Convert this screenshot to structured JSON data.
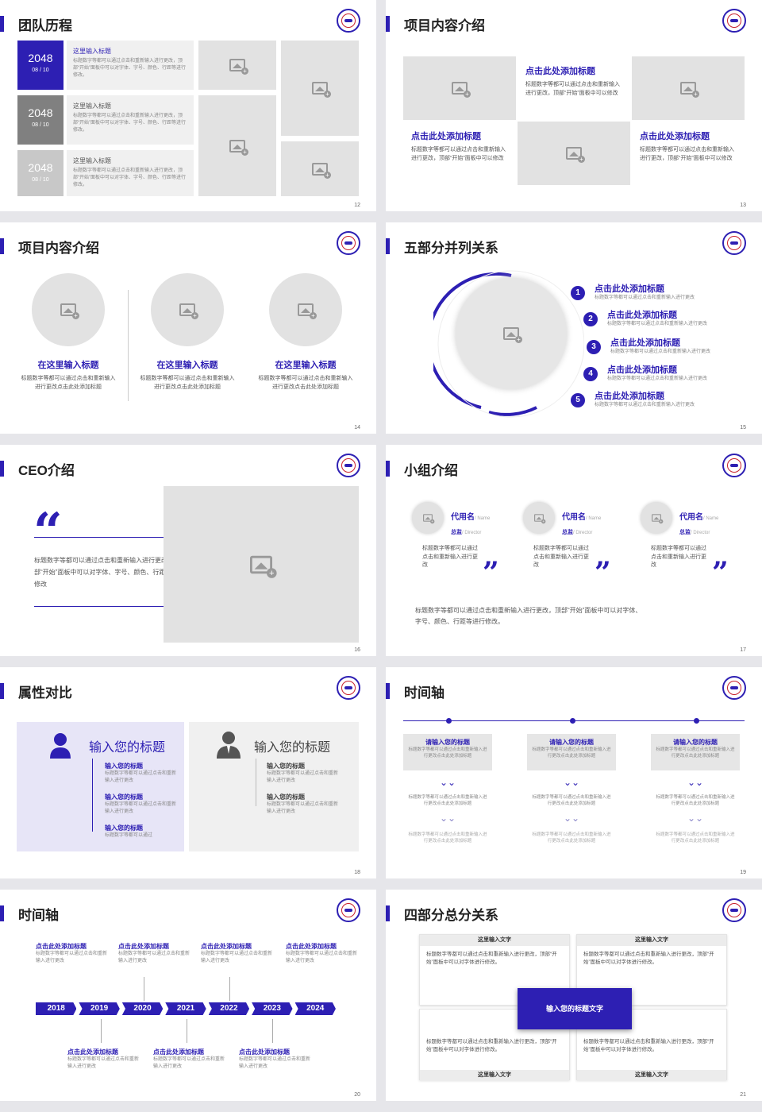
{
  "s12": {
    "title": "团队历程",
    "page": "12",
    "items": [
      {
        "year": "2048",
        "date": "08 / 10",
        "title": "这里输入标题",
        "text": "标题数字等都可以通过点击和重新输入进行更改，顶部“开始”面板中可以对字体、字号、颜色、行距等进行修改。"
      },
      {
        "year": "2048",
        "date": "08 / 10",
        "title": "这里输入标题",
        "text": "标题数字等都可以通过点击和重新输入进行更改，顶部“开始”面板中可以对字体、字号、颜色、行距等进行修改。"
      },
      {
        "year": "2048",
        "date": "08 / 10",
        "title": "这里输入标题",
        "text": "标题数字等都可以通过点击和重新输入进行更改，顶部“开始”面板中可以对字体、字号、颜色、行距等进行修改。"
      }
    ]
  },
  "s13": {
    "title": "项目内容介绍",
    "page": "13",
    "items": [
      {
        "title": "点击此处添加标题",
        "text": "标题数字等都可以通过点击和重新输入进行更改，顶部“开始”面板中可以修改"
      },
      {
        "title": "点击此处添加标题",
        "text": "标题数字等都可以通过点击和重新输入进行更改，顶部“开始”面板中可以修改"
      },
      {
        "title": "点击此处添加标题",
        "text": "标题数字等都可以通过点击和重新输入进行更改，顶部“开始”面板中可以修改"
      }
    ]
  },
  "s14": {
    "title": "项目内容介绍",
    "page": "14",
    "items": [
      {
        "title": "在这里输入标题",
        "text": "标题数字等都可以通过点击和重新输入进行更改点击此处添加标题"
      },
      {
        "title": "在这里输入标题",
        "text": "标题数字等都可以通过点击和重新输入进行更改点击此处添加标题"
      },
      {
        "title": "在这里输入标题",
        "text": "标题数字等都可以通过点击和重新输入进行更改点击此处添加标题"
      }
    ]
  },
  "s15": {
    "title": "五部分并列关系",
    "page": "15",
    "items": [
      {
        "n": "1",
        "title": "点击此处添加标题",
        "text": "标题数字等都可以通过点击和重新输入进行更改"
      },
      {
        "n": "2",
        "title": "点击此处添加标题",
        "text": "标题数字等都可以通过点击和重新输入进行更改"
      },
      {
        "n": "3",
        "title": "点击此处添加标题",
        "text": "标题数字等都可以通过点击和重新输入进行更改"
      },
      {
        "n": "4",
        "title": "点击此处添加标题",
        "text": "标题数字等都可以通过点击和重新输入进行更改"
      },
      {
        "n": "5",
        "title": "点击此处添加标题",
        "text": "标题数字等都可以通过点击和重新输入进行更改"
      }
    ]
  },
  "s16": {
    "title": "CEO介绍",
    "page": "16",
    "text": "标题数字等都可以通过点击和重新输入进行更改，顶部“开始”面板中可以对字体、字号、颜色、行距等进行修改"
  },
  "s17": {
    "title": "小组介绍",
    "page": "17",
    "members": [
      {
        "name": "代用名",
        "name_en": "/ Name",
        "role": "总监",
        "role_en": "/ Director",
        "text": "标题数字等都可以通过点击和重新输入进行更改"
      },
      {
        "name": "代用名",
        "name_en": "/ Name",
        "role": "总监",
        "role_en": "/ Director",
        "text": "标题数字等都可以通过点击和重新输入进行更改"
      },
      {
        "name": "代用名",
        "name_en": "/ Name",
        "role": "总监",
        "role_en": "/ Director",
        "text": "标题数字等都可以通过点击和重新输入进行更改"
      }
    ],
    "bottom": "标题数字等都可以通过点击和重新输入进行更改，顶部“开始”面板中可以对字体、字号、颜色、行距等进行修改。"
  },
  "s18": {
    "title": "属性对比",
    "page": "18",
    "left": {
      "heading": "输入您的标题",
      "items": [
        {
          "title": "输入您的标题",
          "text": "标题数字等都可以通过点击和重新输入进行更改"
        },
        {
          "title": "输入您的标题",
          "text": "标题数字等都可以通过点击和重新输入进行更改"
        },
        {
          "title": "输入您的标题",
          "text": "标题数字等都可以通过"
        }
      ]
    },
    "right": {
      "heading": "输入您的标题",
      "items": [
        {
          "title": "输入您的标题",
          "text": "标题数字等都可以通过点击和重新输入进行更改"
        },
        {
          "title": "输入您的标题",
          "text": "标题数字等都可以通过点击和重新输入进行更改"
        }
      ]
    }
  },
  "s19": {
    "title": "时间轴",
    "page": "19",
    "cols": [
      {
        "head": "请输入您的标题",
        "text": "标题数字等都可以通过点击和重新输入进行更改点击此处添加标题",
        "t2": "标题数字等都可以通过点击和重新输入进行更改点击此处添加标题",
        "t3": "标题数字等都可以通过点击和重新输入进行更改点击此处添加标题"
      },
      {
        "head": "请输入您的标题",
        "text": "标题数字等都可以通过点击和重新输入进行更改点击此处添加标题",
        "t2": "标题数字等都可以通过点击和重新输入进行更改点击此处添加标题",
        "t3": "标题数字等都可以通过点击和重新输入进行更改点击此处添加标题"
      },
      {
        "head": "请输入您的标题",
        "text": "标题数字等都可以通过点击和重新输入进行更改点击此处添加标题",
        "t2": "标题数字等都可以通过点击和重新输入进行更改点击此处添加标题",
        "t3": "标题数字等都可以通过点击和重新输入进行更改点击此处添加标题"
      }
    ]
  },
  "s20": {
    "title": "时间轴",
    "page": "20",
    "years": [
      "2018",
      "2019",
      "2020",
      "2021",
      "2022",
      "2023",
      "2024"
    ],
    "top": [
      {
        "title": "点击此处添加标题",
        "text": "标题数字等都可以通过点击和重新输入进行更改"
      },
      {
        "title": "点击此处添加标题",
        "text": "标题数字等都可以通过点击和重新输入进行更改"
      },
      {
        "title": "点击此处添加标题",
        "text": "标题数字等都可以通过点击和重新输入进行更改"
      },
      {
        "title": "点击此处添加标题",
        "text": "标题数字等都可以通过点击和重新输入进行更改"
      }
    ],
    "bottom": [
      {
        "title": "点击此处添加标题",
        "text": "标题数字等都可以通过点击和重新输入进行更改"
      },
      {
        "title": "点击此处添加标题",
        "text": "标题数字等都可以通过点击和重新输入进行更改"
      },
      {
        "title": "点击此处添加标题",
        "text": "标题数字等都可以通过点击和重新输入进行更改"
      }
    ]
  },
  "s21": {
    "title": "四部分总分关系",
    "page": "21",
    "center": "输入您的标题文字",
    "boxes": [
      {
        "head": "这里输入文字",
        "text": "标题数字等都可以通过点击和重新输入进行更改，顶部“开始”面板中可以对字体进行修改。"
      },
      {
        "head": "这里输入文字",
        "text": "标题数字等都可以通过点击和重新输入进行更改，顶部“开始”面板中可以对字体进行修改。"
      },
      {
        "head": "这里输入文字",
        "text": "标题数字等都可以通过点击和重新输入进行更改，顶部“开始”面板中可以对字体进行修改。"
      },
      {
        "head": "这里输入文字",
        "text": "标题数字等都可以通过点击和重新输入进行更改，顶部“开始”面板中可以对字体进行修改。"
      }
    ]
  }
}
